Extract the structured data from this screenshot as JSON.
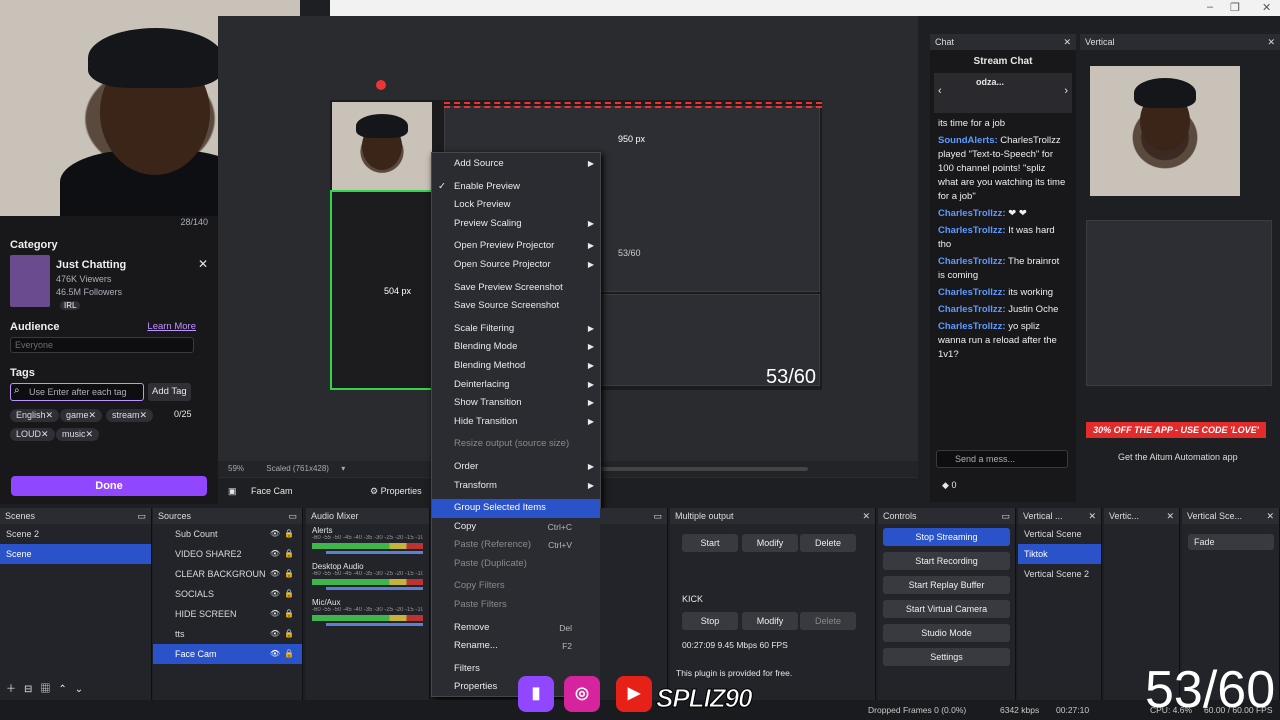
{
  "window": {
    "minimize": "–",
    "restore": "❐",
    "close": "✕"
  },
  "twitch": {
    "char_count": "28/140",
    "category_label": "Category",
    "category_name": "Just Chatting",
    "viewers": "476K Viewers",
    "followers": "46.5M Followers",
    "category_tag": "IRL",
    "audience_label": "Audience",
    "learn_more": "Learn More",
    "audience_value": "Everyone",
    "tags_label": "Tags",
    "tag_placeholder": "Use Enter after each tag",
    "add_tag": "Add Tag",
    "tag_count": "0/25",
    "tags": [
      "English",
      "game",
      "stream",
      "LOUD",
      "music"
    ],
    "done": "Done"
  },
  "preview": {
    "measure_top": "950 px",
    "measure_left": "504 px",
    "fps_small": "53/60",
    "fps_overlay": "53/60",
    "zoom": "59%",
    "scaled": "Scaled (761x428)",
    "source_name": "Face Cam",
    "properties": "Properties"
  },
  "context_menu": {
    "items": [
      {
        "label": "Add Source",
        "arrow": true
      },
      {
        "sep": true
      },
      {
        "label": "Enable Preview",
        "check": true
      },
      {
        "label": "Lock Preview"
      },
      {
        "label": "Preview Scaling",
        "arrow": true
      },
      {
        "sep": true
      },
      {
        "label": "Open Preview Projector",
        "arrow": true
      },
      {
        "label": "Open Source Projector",
        "arrow": true
      },
      {
        "sep": true
      },
      {
        "label": "Save Preview Screenshot"
      },
      {
        "label": "Save Source Screenshot"
      },
      {
        "sep": true
      },
      {
        "label": "Scale Filtering",
        "arrow": true
      },
      {
        "label": "Blending Mode",
        "arrow": true
      },
      {
        "label": "Blending Method",
        "arrow": true
      },
      {
        "label": "Deinterlacing",
        "arrow": true
      },
      {
        "label": "Show Transition",
        "arrow": true
      },
      {
        "label": "Hide Transition",
        "arrow": true
      },
      {
        "sep": true
      },
      {
        "label": "Resize output (source size)",
        "disabled": true
      },
      {
        "sep": true
      },
      {
        "label": "Order",
        "arrow": true
      },
      {
        "label": "Transform",
        "arrow": true
      },
      {
        "sep": true
      },
      {
        "label": "Group Selected Items",
        "highlight": true
      },
      {
        "label": "Copy",
        "shortcut": "Ctrl+C"
      },
      {
        "label": "Paste (Reference)",
        "shortcut": "Ctrl+V",
        "disabled": true
      },
      {
        "label": "Paste (Duplicate)",
        "disabled": true
      },
      {
        "sep": true
      },
      {
        "label": "Copy Filters",
        "disabled": true
      },
      {
        "label": "Paste Filters",
        "disabled": true
      },
      {
        "sep": true
      },
      {
        "label": "Remove",
        "shortcut": "Del"
      },
      {
        "label": "Rename...",
        "shortcut": "F2"
      },
      {
        "sep": true
      },
      {
        "label": "Filters"
      },
      {
        "label": "Properties"
      }
    ]
  },
  "chat": {
    "title": "Chat",
    "header": "Stream Chat",
    "gift_user": "odza...",
    "messages": [
      {
        "user": "",
        "text": "its time for a job"
      },
      {
        "user": "SoundAlerts:",
        "text": "CharlesTrollzz played \"Text-to-Speech\" for 100 channel points! \"spliz what are you watching its time for a job\""
      },
      {
        "user": "CharlesTrollzz:",
        "text": "❤ ❤"
      },
      {
        "user": "CharlesTrollzz:",
        "text": "It was hard tho"
      },
      {
        "user": "CharlesTrollzz:",
        "text": "The brainrot is coming"
      },
      {
        "user": "CharlesTrollzz:",
        "text": "its working"
      },
      {
        "user": "CharlesTrollzz:",
        "text": "Justin Oche"
      },
      {
        "user": "CharlesTrollzz:",
        "text": "yo spliz wanna run a reload after the 1v1?"
      }
    ],
    "send_placeholder": "Send a mess...",
    "points": "0"
  },
  "vertical": {
    "title": "Vertical",
    "promo": "30% OFF THE APP - USE CODE 'LOVE'",
    "get_app": "Get the Aitum Automation app"
  },
  "docks": {
    "scenes": {
      "title": "Scenes",
      "items": [
        "Scene 2",
        "Scene"
      ],
      "selected": 1
    },
    "sources": {
      "title": "Sources",
      "items": [
        "Sub Count",
        "VIDEO SHARE2",
        "CLEAR BACKGROUN",
        "SOCIALS",
        "HIDE SCREEN",
        "tts",
        "Face Cam"
      ],
      "selected": 6
    },
    "mixer": {
      "title": "Audio Mixer",
      "channels": [
        "Alerts",
        "Desktop Audio",
        "Mic/Aux"
      ],
      "scale": "-60 -55 -50 -45 -40 -35 -30 -25 -20 -15 -10 -5 0"
    },
    "multiple_output": {
      "title": "Multiple output",
      "start": "Start",
      "modify": "Modify",
      "delete": "Delete",
      "target": "KICK",
      "stop": "Stop",
      "stats": "00:27:09 9.45 Mbps 60 FPS",
      "note": "This plugin is provided for free."
    },
    "controls": {
      "title": "Controls",
      "buttons": [
        "Stop Streaming",
        "Start Recording",
        "Start Replay Buffer",
        "Start Virtual Camera",
        "Studio Mode",
        "Settings"
      ]
    },
    "vertical_scenes": {
      "title": "Vertical ...",
      "items": [
        "Vertical Scene",
        "Tiktok",
        "Vertical Scene 2"
      ],
      "selected": 1
    },
    "vertical_sources": {
      "title": "Vertic..."
    },
    "vertical_transitions": {
      "title": "Vertical Sce...",
      "value": "Fade"
    }
  },
  "status": {
    "dropped": "Dropped Frames 0 (0.0%)",
    "kbps": "6342 kbps",
    "time": "00:27:10",
    "cpu": "CPU: 4.6%",
    "fps": "60.00 / 60.00 FPS"
  },
  "overlay": {
    "fps": "53/60",
    "brand": "SPLIZ90"
  },
  "colors": {
    "accent": "#2a52c9",
    "twitch": "#9147ff",
    "promo": "#e22b2b"
  }
}
